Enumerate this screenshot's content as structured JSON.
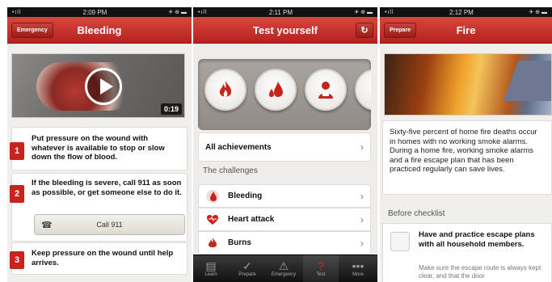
{
  "screens": {
    "bleeding": {
      "status": {
        "signal": "•ıll",
        "time": "2:09 PM",
        "right": "✈ ⊕ ▬"
      },
      "nav": {
        "back_label": "Emergency",
        "title": "Bleeding"
      },
      "video": {
        "duration": "0:19"
      },
      "steps": [
        {
          "num": "1",
          "text": "Put pressure on the wound with whatever is available to stop or slow down the flow of blood."
        },
        {
          "num": "2",
          "text": "If the bleeding is severe, call 911 as soon as possible, or get someone else to do it."
        },
        {
          "num": "3",
          "text": "Keep pressure on the wound until help arrives."
        }
      ],
      "call_button": "Call 911"
    },
    "test": {
      "status": {
        "signal": "•ıll",
        "time": "2:11 PM",
        "right": "✈ ⊕ ▬"
      },
      "nav": {
        "title": "Test yourself",
        "refresh": "↻"
      },
      "achievements_label": "All achievements",
      "challenges_header": "The challenges",
      "challenges": [
        "Bleeding",
        "Heart attack",
        "Burns"
      ],
      "chevron": "›",
      "tabs": [
        "Learn",
        "Prepare",
        "Emergency",
        "Test",
        "More"
      ]
    },
    "fire": {
      "status": {
        "signal": "•ıll",
        "time": "2:12 PM",
        "right": "✈ ⊕ ▬"
      },
      "nav": {
        "back_label": "Prepare",
        "title": "Fire"
      },
      "description": "Sixty-five percent of home fire deaths occur in homes with no working smoke alarms. During a home fire, working smoke alarms and a fire escape plan that has been practiced regularly can save lives.",
      "checklist_header": "Before checklist",
      "checklist_title": "Have and practice escape plans with all household members.",
      "checklist_sub": "Make sure the escape route is always kept clear, and that the door"
    }
  },
  "colors": {
    "brand_red": "#c8241e",
    "nav_red": "#d8463d"
  }
}
